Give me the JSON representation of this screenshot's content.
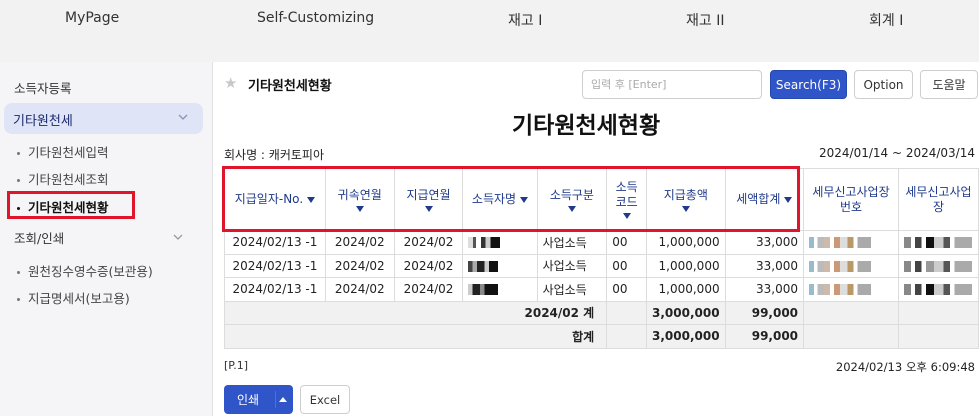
{
  "topnav": {
    "items": [
      "MyPage",
      "Self-Customizing",
      "재고 I",
      "재고 II",
      "회계 I"
    ]
  },
  "sidebar": {
    "section": "소득자등록",
    "group1": "기타원천세",
    "group1_items": [
      "기타원천세입력",
      "기타원천세조회",
      "기타원천세현황"
    ],
    "group2": "조회/인쇄",
    "group2_items": [
      "원천징수영수증(보관용)",
      "지급명세서(보고용)"
    ]
  },
  "header": {
    "crumb": "기타원천세현황",
    "search_placeholder": "입력 후 [Enter]",
    "search_button": "Search(F3)",
    "option_button": "Option",
    "help_button": "도움말"
  },
  "report": {
    "title": "기타원천세현황",
    "company": "회사명 : 캐커토피아",
    "date_range": "2024/01/14 ~ 2024/03/14"
  },
  "table": {
    "headers": [
      "지급일자-No.",
      "귀속연월",
      "지급연월",
      "소득자명",
      "소득구분",
      "소득코드",
      "지급총액",
      "세액합계",
      "세무신고사업장번호",
      "세무신고사업장"
    ],
    "rows": [
      [
        "2024/02/13 -1",
        "2024/02",
        "2024/02",
        "",
        "사업소득",
        "00",
        "1,000,000",
        "33,000",
        "",
        ""
      ],
      [
        "2024/02/13 -1",
        "2024/02",
        "2024/02",
        "",
        "사업소득",
        "00",
        "1,000,000",
        "33,000",
        "",
        ""
      ],
      [
        "2024/02/13 -1",
        "2024/02",
        "2024/02",
        "",
        "사업소득",
        "00",
        "1,000,000",
        "33,000",
        "",
        ""
      ]
    ],
    "subtotal": {
      "label": "2024/02 계",
      "total": "3,000,000",
      "tax": "99,000"
    },
    "grandtotal": {
      "label": "합계",
      "total": "3,000,000",
      "tax": "99,000"
    }
  },
  "footer": {
    "page": "[P.1]",
    "timestamp": "2024/02/13 오후 6:09:48",
    "print_button": "인쇄",
    "excel_button": "Excel"
  },
  "colors": {
    "primary": "#2f55c8",
    "highlight_box": "#e0142b",
    "header_text": "#1f3a8a",
    "sidebar_active": "#dfe4f6"
  }
}
